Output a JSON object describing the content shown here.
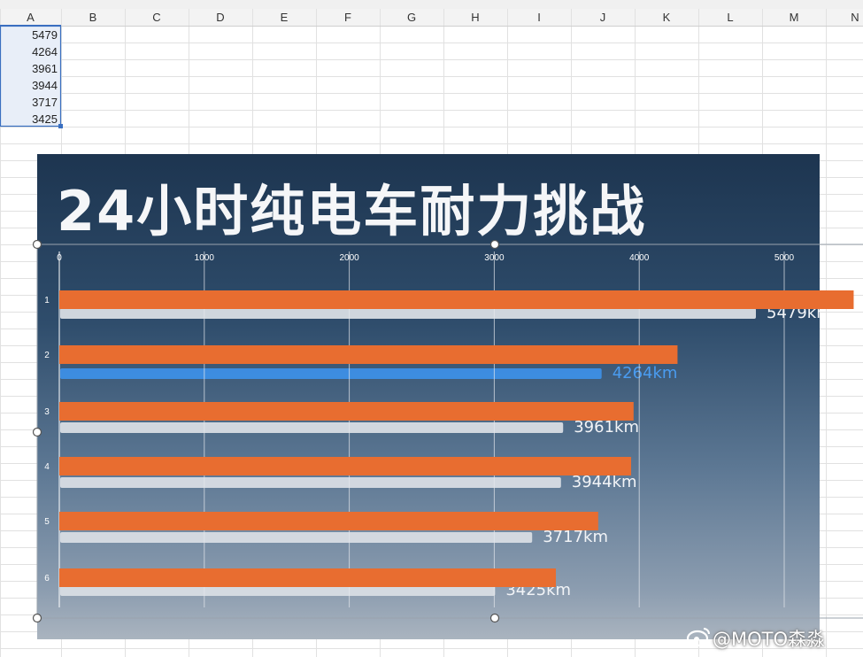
{
  "sheet": {
    "columns": [
      "A",
      "B",
      "C",
      "D",
      "E",
      "F",
      "G",
      "H",
      "I",
      "J",
      "K",
      "L",
      "M",
      "N"
    ],
    "column_a_values": [
      "5479",
      "4264",
      "3961",
      "3944",
      "3717",
      "3425"
    ]
  },
  "image": {
    "title": "24小时纯电车耐力挑战",
    "watermark": "@MOTO森淼"
  },
  "colors": {
    "bar": "#e86d30",
    "image_bar": "#d8dde4",
    "image_bar_highlight": "#3d8fe6"
  },
  "chart_data": {
    "type": "bar",
    "orientation": "horizontal",
    "categories": [
      "1",
      "2",
      "3",
      "4",
      "5",
      "6"
    ],
    "values": [
      5479,
      4264,
      3961,
      3944,
      3717,
      3425
    ],
    "xlim": [
      0,
      5500
    ],
    "xticks": [
      0,
      1000,
      2000,
      3000,
      4000,
      5000
    ],
    "image_value_labels": [
      "5479km",
      "4264km",
      "3961km",
      "3944km",
      "3717km",
      "3425km"
    ],
    "title": "",
    "xlabel": "",
    "ylabel": "",
    "grid": true,
    "legend": "none"
  }
}
